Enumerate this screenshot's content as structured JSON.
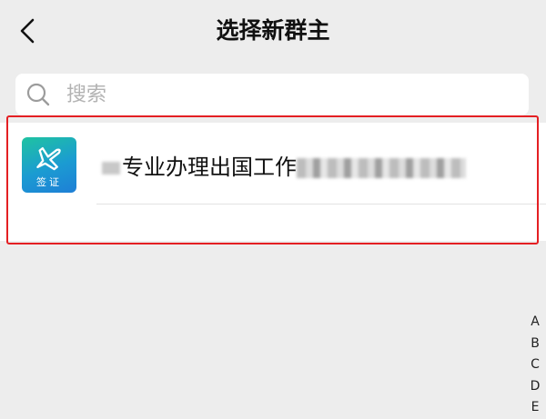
{
  "header": {
    "title": "选择新群主",
    "back_icon": "chevron-left-icon"
  },
  "search": {
    "placeholder": "搜索",
    "value": "",
    "icon": "search-icon"
  },
  "members": [
    {
      "name": "专业办理出国工作",
      "avatar_label": "签证",
      "avatar_icon": "airplane-icon"
    }
  ],
  "index_letters": [
    "A",
    "B",
    "C",
    "D",
    "E"
  ],
  "colors": {
    "background": "#ededed",
    "avatar_start": "#1fc3a1",
    "avatar_end": "#1e7fd6",
    "highlight": "#e41f23"
  }
}
